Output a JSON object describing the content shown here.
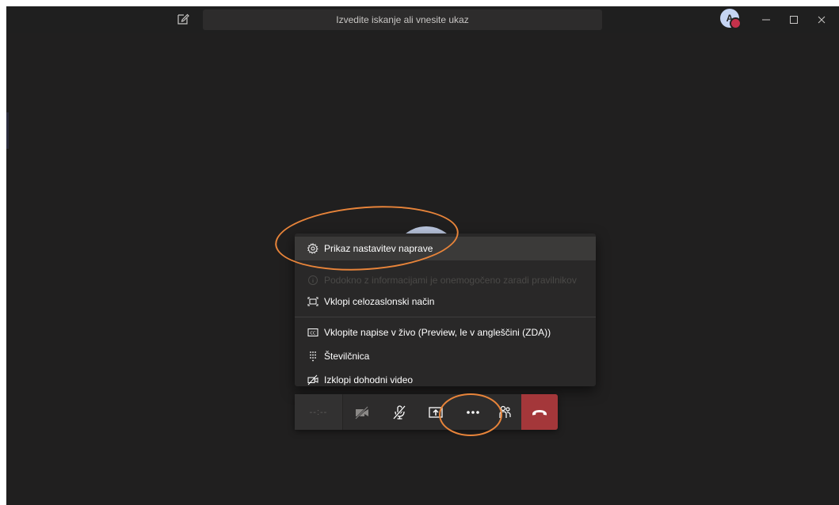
{
  "search": {
    "placeholder": "Izvedite iskanje ali vnesite ukaz"
  },
  "user": {
    "initial": "A"
  },
  "menu": {
    "items": [
      {
        "icon": "gear-icon",
        "label": "Prikaz nastavitev naprave",
        "disabled": false
      },
      {
        "icon": "info-icon",
        "label": "Podokno z informacijami je onemogočeno zaradi pravilnikov",
        "disabled": true
      },
      {
        "icon": "fullscreen-icon",
        "label": "Vklopi celozaslonski način",
        "disabled": false
      },
      {
        "icon": "closed-captions-icon",
        "label": "Vklopite napise v živo (Preview, le v angleščini (ZDA))",
        "disabled": false
      },
      {
        "icon": "dialpad-icon",
        "label": "Številčnica",
        "disabled": false
      },
      {
        "icon": "video-off-icon",
        "label": "Izklopi dohodni video",
        "disabled": false
      }
    ]
  },
  "toolbar": {
    "timer": "--:--"
  },
  "colors": {
    "background": "#201f1f",
    "hangup": "#a4373a",
    "annotation": "#e8843a",
    "status_busy": "#c4314b"
  }
}
